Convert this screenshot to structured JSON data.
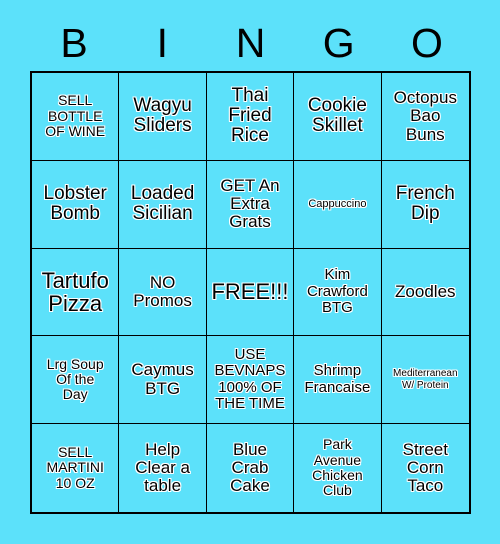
{
  "card": {
    "background_color": "#5ce1fa",
    "grid_line_color": "#000000",
    "text_color": "#000000",
    "text_outline_color": "#ffffff"
  },
  "header": {
    "letters": [
      {
        "label": "B"
      },
      {
        "label": "I"
      },
      {
        "label": "N"
      },
      {
        "label": "G"
      },
      {
        "label": "O"
      }
    ]
  },
  "grid": {
    "columns": 5,
    "rows": 5,
    "cells": [
      {
        "text": "SELL\nBOTTLE\nOF WINE",
        "size": "md",
        "free": false
      },
      {
        "text": "Wagyu\nSliders",
        "size": "xxl",
        "free": false
      },
      {
        "text": "Thai\nFried\nRice",
        "size": "xxl",
        "free": false
      },
      {
        "text": "Cookie\nSkillet",
        "size": "xxl",
        "free": false
      },
      {
        "text": "Octopus\nBao\nBuns",
        "size": "xl",
        "free": false
      },
      {
        "text": "Lobster\nBomb",
        "size": "xxl",
        "free": false
      },
      {
        "text": "Loaded\nSicilian",
        "size": "xxl",
        "free": false
      },
      {
        "text": "GET An\nExtra\nGrats",
        "size": "xl",
        "free": false
      },
      {
        "text": "Cappuccino",
        "size": "sm",
        "free": false
      },
      {
        "text": "French\nDip",
        "size": "xxl",
        "free": false
      },
      {
        "text": "Tartufo\nPizza",
        "size": "huge",
        "free": false
      },
      {
        "text": "NO\nPromos",
        "size": "xl",
        "free": false
      },
      {
        "text": "FREE!!!",
        "size": "huge",
        "free": true
      },
      {
        "text": "Kim\nCrawford\nBTG",
        "size": "lg",
        "free": false
      },
      {
        "text": "Zoodles",
        "size": "xl",
        "free": false
      },
      {
        "text": "Lrg Soup\nOf the\nDay",
        "size": "md",
        "free": false
      },
      {
        "text": "Caymus\nBTG",
        "size": "xl",
        "free": false
      },
      {
        "text": "USE\nBEVNAPS\n100% OF\nTHE TIME",
        "size": "lg",
        "free": false
      },
      {
        "text": "Shrimp\nFrancaise",
        "size": "lg",
        "free": false
      },
      {
        "text": "Mediterranean\nW/ Protein",
        "size": "xs",
        "free": false
      },
      {
        "text": "SELL\nMARTINI\n10 OZ",
        "size": "md",
        "free": false
      },
      {
        "text": "Help\nClear a\ntable",
        "size": "xl",
        "free": false
      },
      {
        "text": "Blue\nCrab\nCake",
        "size": "xl",
        "free": false
      },
      {
        "text": "Park\nAvenue\nChicken\nClub",
        "size": "md",
        "free": false
      },
      {
        "text": "Street\nCorn\nTaco",
        "size": "xl",
        "free": false
      }
    ]
  }
}
